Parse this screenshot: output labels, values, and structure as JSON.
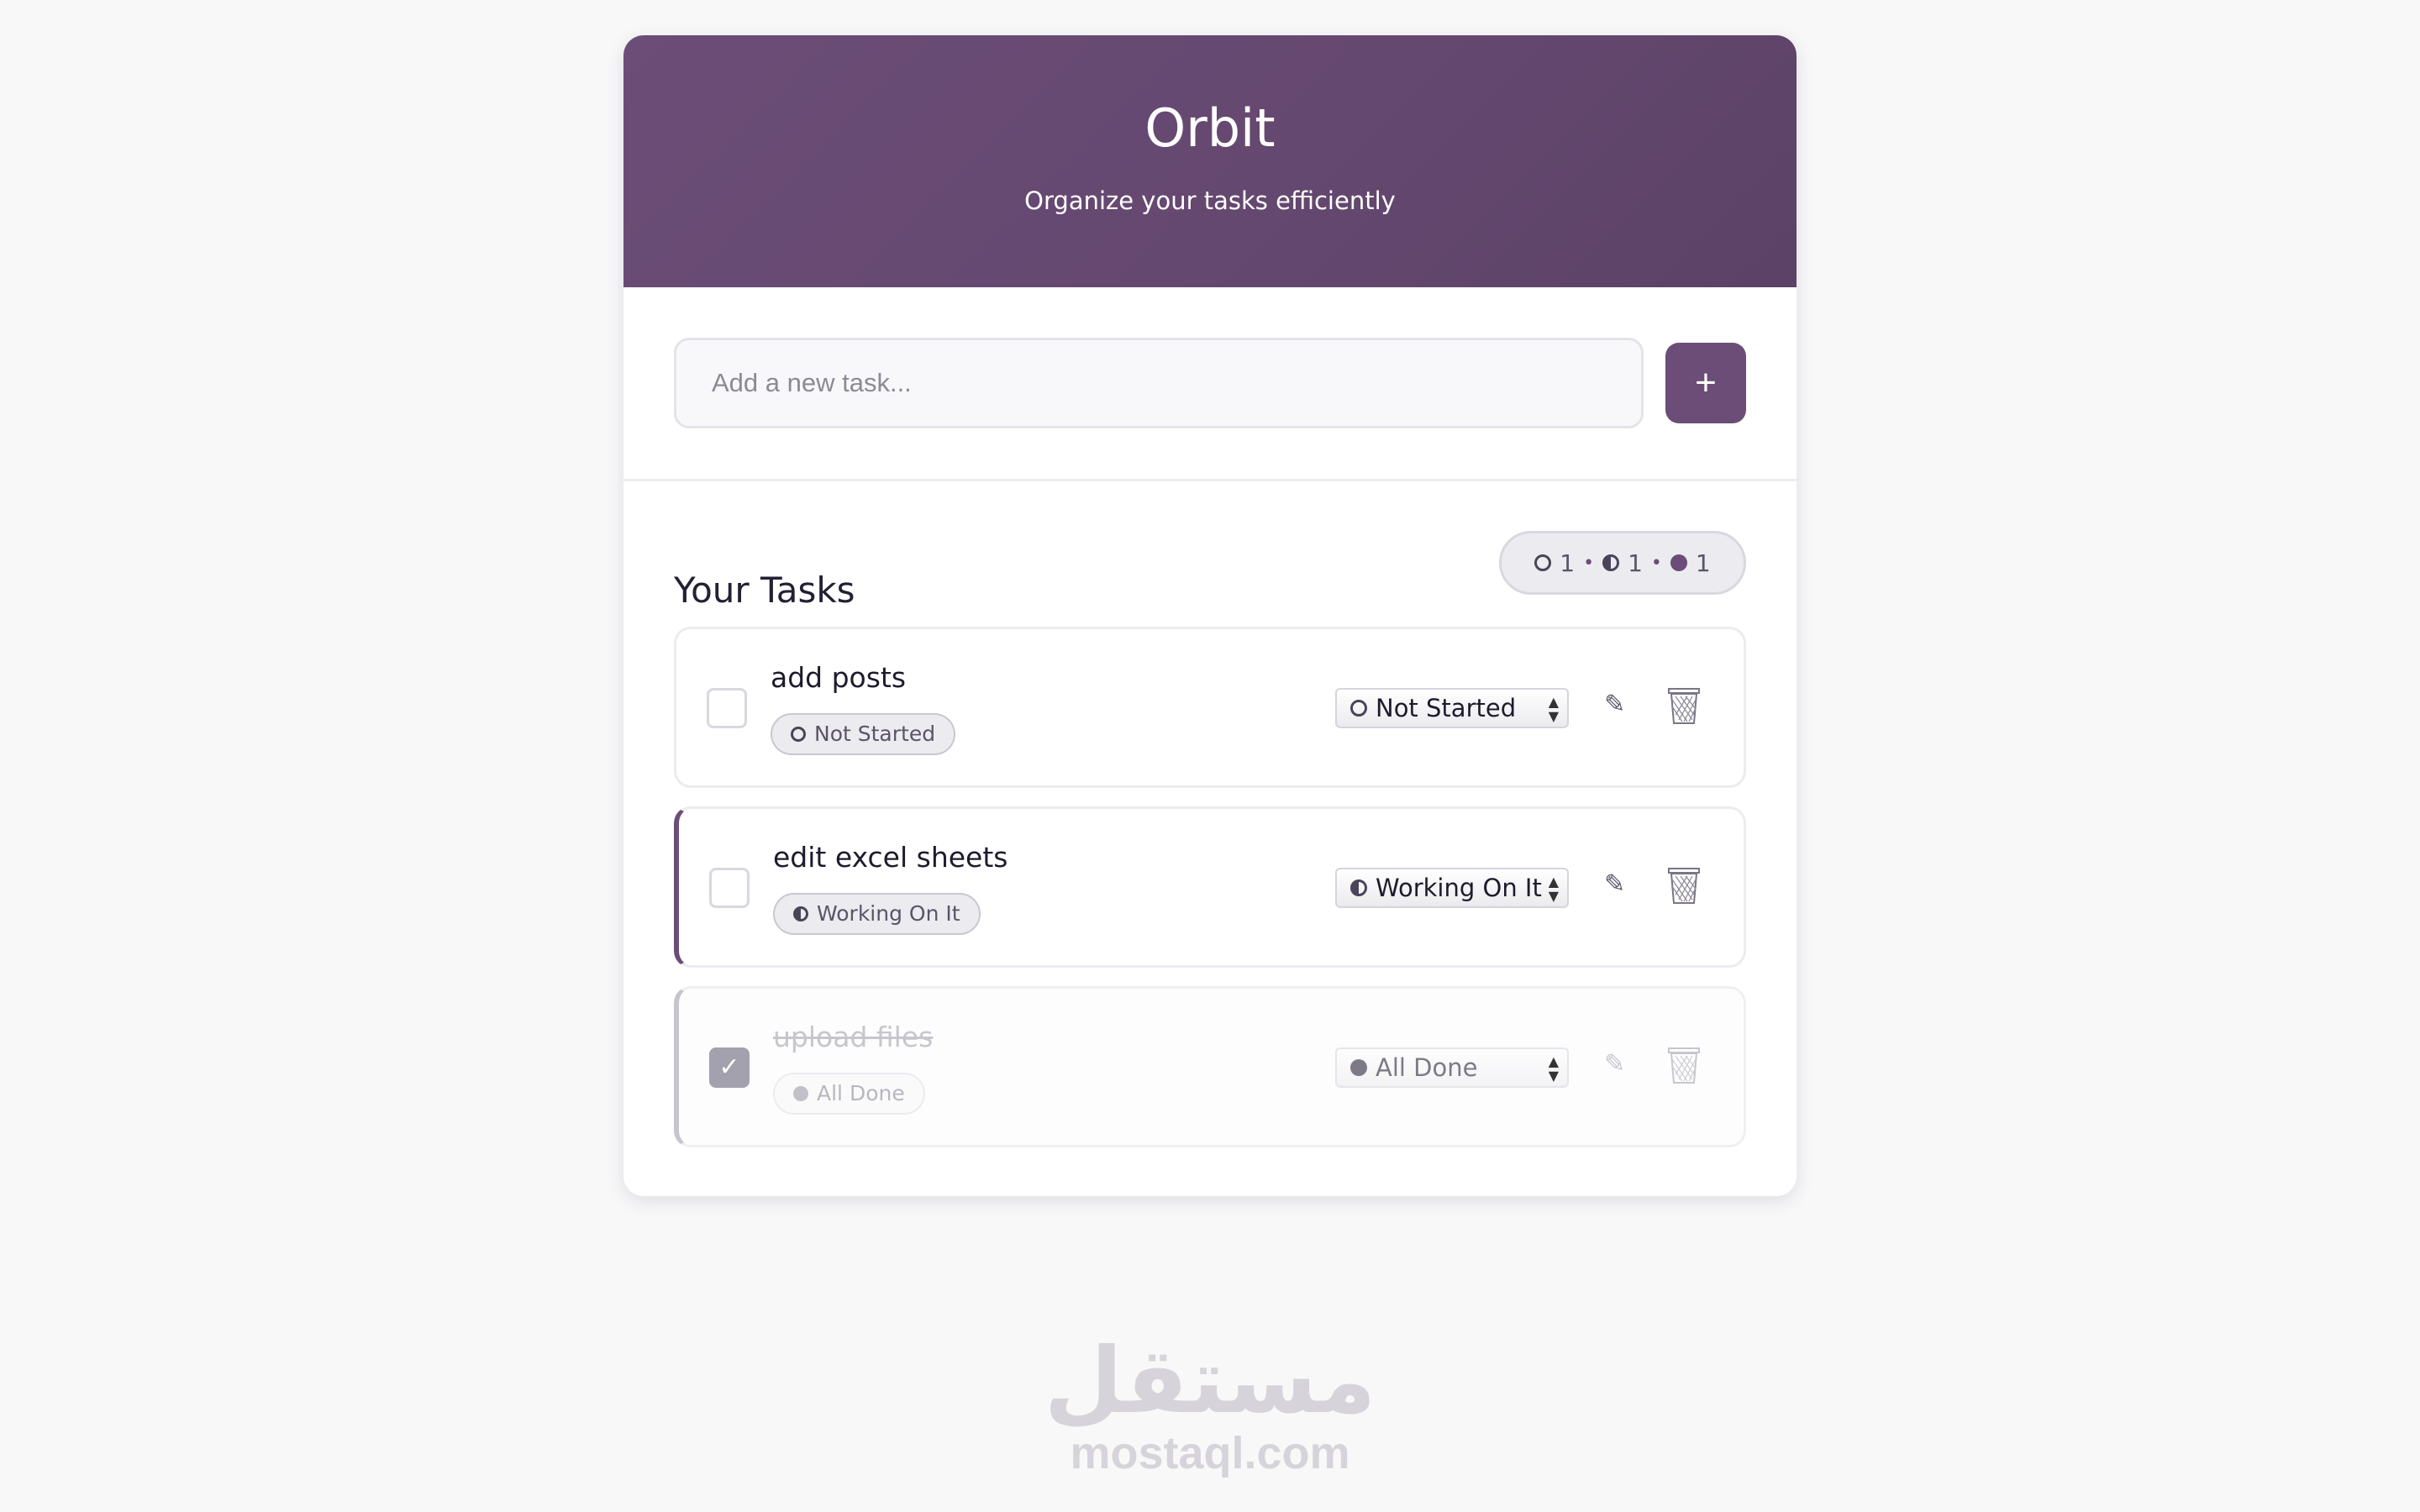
{
  "header": {
    "title": "Orbit",
    "subtitle": "Organize your tasks efficiently"
  },
  "add_task": {
    "placeholder": "Add a new task...",
    "button_label": "+"
  },
  "tasks_section": {
    "title": "Your Tasks",
    "stats": {
      "not_started": "1",
      "working": "1",
      "done": "1",
      "separator": "•"
    }
  },
  "tasks": [
    {
      "name": "add posts",
      "status": "Not Started",
      "status_icon": "circle-empty-icon",
      "checked": false
    },
    {
      "name": "edit excel sheets",
      "status": "Working On It",
      "status_icon": "circle-half-icon",
      "checked": false
    },
    {
      "name": "upload files",
      "status": "All Done",
      "status_icon": "circle-full-icon",
      "checked": true
    }
  ],
  "icons": {
    "edit": "pencil-icon",
    "delete": "trash-icon",
    "check": "checkmark-icon"
  },
  "colors": {
    "accent": "#6b4d77",
    "background": "#f8f8f9"
  },
  "watermark": {
    "arabic": "مستقل",
    "latin": "mostaql.com"
  }
}
